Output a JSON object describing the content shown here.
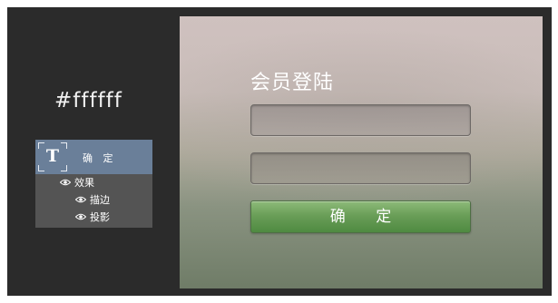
{
  "left_panel": {
    "color_label": "#ffffff",
    "layers": {
      "text_layer_name": "确 定",
      "text_layer_icon": "text-layer-icon",
      "effects_label": "效果",
      "stroke_label": "描边",
      "shadow_label": "投影",
      "visibility_icon": "eye-icon"
    }
  },
  "login_panel": {
    "title": "会员登陆",
    "username_value": "",
    "password_value": "",
    "confirm_label": "确  定"
  },
  "colors": {
    "frame": "#2b2b2b",
    "layer_selected": "#6a7f99",
    "layers_bg": "#545454",
    "button_green": "#6a9e58"
  }
}
